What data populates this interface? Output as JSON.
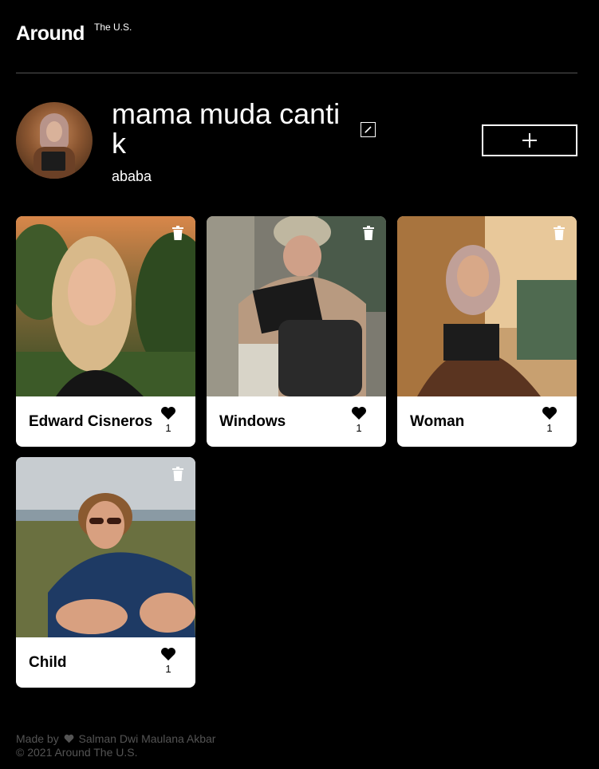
{
  "header": {
    "logo_main": "Around",
    "logo_sup": "The U.S."
  },
  "profile": {
    "name": "mama muda cantik",
    "about": "ababa",
    "add_label": "+"
  },
  "cards": [
    {
      "title": "Edward Cisneros",
      "likes": "1"
    },
    {
      "title": "Windows",
      "likes": "1"
    },
    {
      "title": "Woman",
      "likes": "1"
    },
    {
      "title": "Child",
      "likes": "1"
    }
  ],
  "footer": {
    "made_by_prefix": "Made by",
    "author": "Salman Dwi Maulana Akbar",
    "copyright": "© 2021 Around The U.S."
  },
  "colors": {
    "background": "#000000",
    "card": "#ffffff",
    "footer_text": "#545454"
  },
  "icons": [
    "edit-icon",
    "plus-icon",
    "trash-icon",
    "heart-icon"
  ]
}
